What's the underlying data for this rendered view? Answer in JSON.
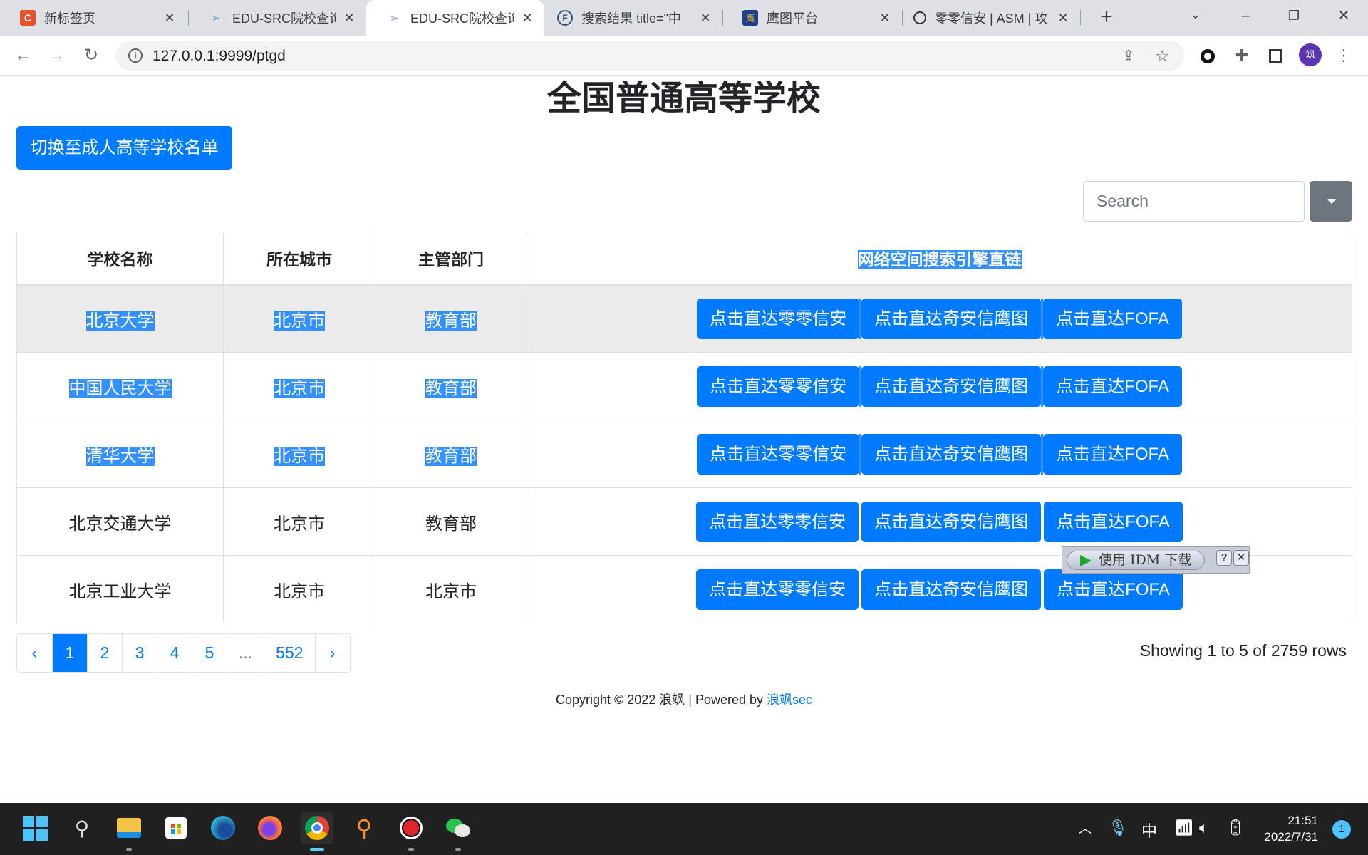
{
  "browser": {
    "tabs": [
      {
        "title": "新标签页",
        "favicon": "c-logo-icon",
        "active": false
      },
      {
        "title": "EDU-SRC院校查询",
        "favicon": "edu-src-icon",
        "active": false
      },
      {
        "title": "EDU-SRC院校查询",
        "favicon": "edu-src-icon",
        "active": true
      },
      {
        "title": "搜索结果 title=\"中",
        "favicon": "fofa-icon",
        "active": false
      },
      {
        "title": "鹰图平台",
        "favicon": "hunter-icon",
        "active": false
      },
      {
        "title": "零零信安 | ASM | 攻",
        "favicon": "circle-icon",
        "active": false
      }
    ],
    "close_glyph": "✕",
    "newtab_glyph": "+",
    "url": "127.0.0.1:9999/ptgd",
    "avatar_text": "飒"
  },
  "page": {
    "title": "全国普通高等学校",
    "switch_button": "切换至成人高等学校名单",
    "search_placeholder": "Search",
    "table": {
      "headers": [
        "学校名称",
        "所在城市",
        "主管部门",
        "网络空间搜索引擎直链"
      ],
      "rows": [
        {
          "name": "北京大学",
          "city": "北京市",
          "dept": "教育部",
          "selected": true,
          "hover": true
        },
        {
          "name": "中国人民大学",
          "city": "北京市",
          "dept": "教育部",
          "selected": true,
          "hover": false
        },
        {
          "name": "清华大学",
          "city": "北京市",
          "dept": "教育部",
          "selected": true,
          "hover": false
        },
        {
          "name": "北京交通大学",
          "city": "北京市",
          "dept": "教育部",
          "selected": false,
          "hover": false
        },
        {
          "name": "北京工业大学",
          "city": "北京市",
          "dept": "北京市",
          "selected": false,
          "hover": false
        }
      ],
      "link_buttons": [
        "点击直达零零信安",
        "点击直达奇安信鹰图",
        "点击直达FOFA"
      ]
    },
    "pagination": {
      "prev": "‹",
      "pages": [
        "1",
        "2",
        "3",
        "4",
        "5",
        "...",
        "552"
      ],
      "current": "1",
      "next": "›"
    },
    "showing_text": "Showing 1 to 5 of 2759 rows",
    "footer": {
      "text": "Copyright © 2022 浪飒 | Powered by ",
      "link": "浪飒sec"
    }
  },
  "idm": {
    "label": "使用 IDM 下载",
    "help": "?",
    "close": "✕"
  },
  "taskbar": {
    "apps": [
      "start-icon",
      "search-icon",
      "file-explorer-icon",
      "store-icon",
      "edge-icon",
      "firefox-icon",
      "chrome-icon",
      "search-tool-icon",
      "record-icon",
      "wechat-icon"
    ],
    "ime": "中",
    "time": "21:51",
    "date": "2022/7/31",
    "notifications": "1"
  },
  "colors": {
    "primary": "#007bff",
    "selection": "#3390ff",
    "secondary": "#6c757d"
  }
}
